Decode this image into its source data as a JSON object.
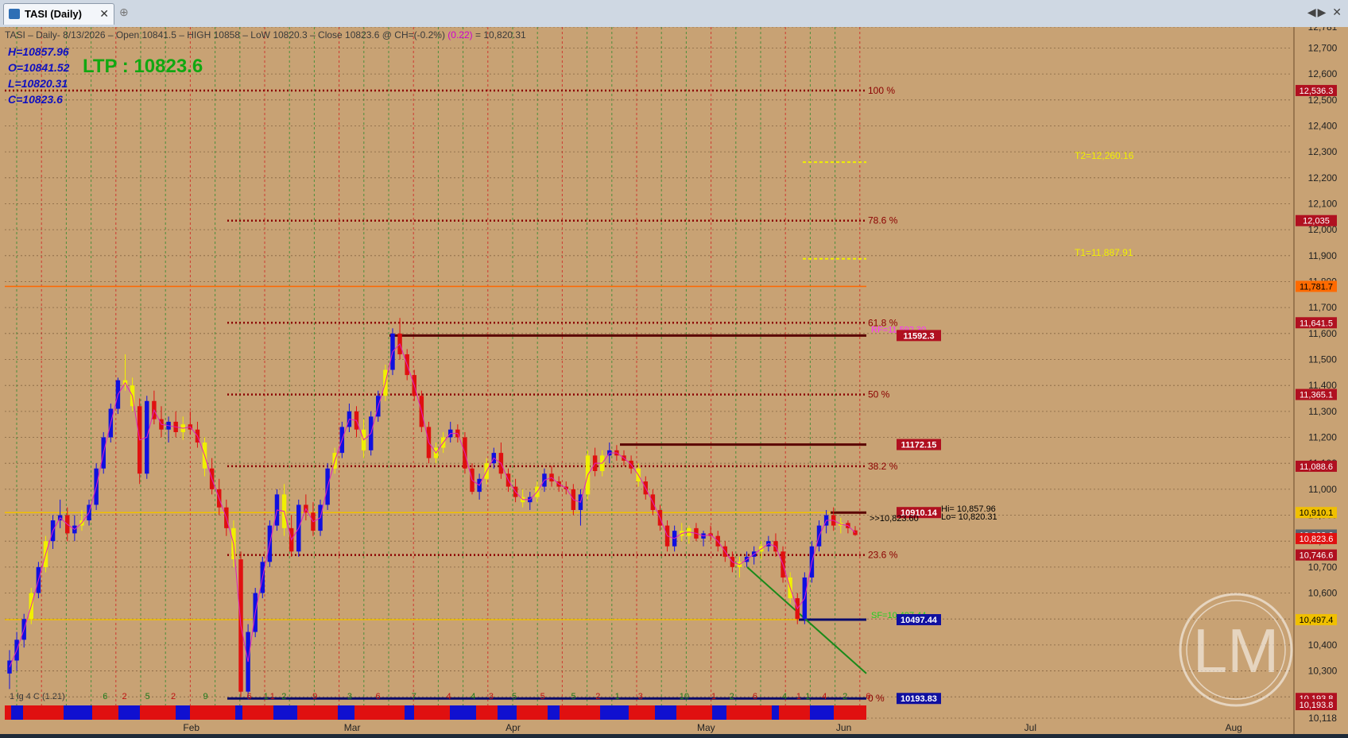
{
  "window": {
    "tab_label": "TASI (Daily)",
    "close_glyph": "✕",
    "add_glyph": "⊕",
    "nav_glyph": "◀▶ ✕"
  },
  "header": {
    "info_line": "TASI – Daily- 8/13/2026 – Open 10841.5 – HIGH 10858 – LoW 10820.3 – Close 10823.6 @ CH=(-0.2%)",
    "info_pink": "(0.22)",
    "info_tail": "= 10,820.31",
    "ohlc": [
      "H=10857.96",
      "O=10841.52",
      "L=10820.31",
      "C=10823.6"
    ],
    "ltp": "LTP : 10823.6",
    "watermark": "LM"
  },
  "colors": {
    "background": "#c8a274",
    "up_candle": "#1010e0",
    "down_candle": "#e01010",
    "neutral_candle": "#f0f000",
    "fib_line": "#8b0000",
    "yellow_line": "#f0c000",
    "orange_line": "#ff6600",
    "navy_line": "#0a0a6a",
    "green_trend": "#1a8a1a"
  },
  "chart_data": {
    "type": "candlestick",
    "symbol": "TASI",
    "timeframe": "Daily",
    "ylim": [
      10118,
      12781
    ],
    "y_ticks": [
      12781,
      12700,
      12600,
      12500,
      12400,
      12300,
      12200,
      12100,
      12000,
      11900,
      11800,
      11700,
      11600,
      11500,
      11400,
      11300,
      11200,
      11100,
      11000,
      10900,
      10800,
      10700,
      10600,
      10500,
      10400,
      10300,
      10200,
      10118
    ],
    "y_tick_labels": [
      "12,781",
      "12,700",
      "12,600",
      "12,500",
      "12,400",
      "12,300",
      "12,200",
      "12,100",
      "12,000",
      "11,900",
      "11,800",
      "11,700",
      "11,600",
      "11,500",
      "11,400",
      "11,300",
      "11,200",
      "11,100",
      "11,000",
      "10,900",
      "10,800",
      "10,700",
      "10,600",
      "10,500",
      "10,400",
      "10,300",
      "10,200",
      "10,118"
    ],
    "month_labels": [
      "Feb",
      "Mar",
      "Apr",
      "May",
      "Jun",
      "Jul",
      "Aug"
    ],
    "month_positions": [
      0.145,
      0.27,
      0.395,
      0.545,
      0.652,
      0.797,
      0.955
    ],
    "fib_levels": [
      {
        "label": "100 %",
        "value": 12536.3
      },
      {
        "label": "78.6 %",
        "value": 12035
      },
      {
        "label": "61.8 %",
        "value": 11641.5
      },
      {
        "label": "50 %",
        "value": 11365.1
      },
      {
        "label": "38.2 %",
        "value": 11088.6
      },
      {
        "label": "23.6 %",
        "value": 10746.6
      },
      {
        "label": "0 %",
        "value": 10193.8
      }
    ],
    "targets": [
      {
        "label": "T2=12,260.16",
        "value": 12260.16
      },
      {
        "label": "T1=11,887.91",
        "value": 11887.91
      }
    ],
    "rf": {
      "label": "RF=11,592.30",
      "value": 11592.3
    },
    "sf": {
      "label": "SF=10,497.44",
      "value": 10497.44
    },
    "level_boxes": [
      {
        "label": "11592.3",
        "value": 11592.3,
        "color": "#b01020"
      },
      {
        "label": "11172.15",
        "value": 11172.15,
        "color": "#b01020"
      },
      {
        "label": "10910.14",
        "value": 10910.14,
        "color": "#b01020"
      },
      {
        "label": "10497.44",
        "value": 10497.44,
        "color": "#1010a0"
      },
      {
        "label": "10193.83",
        "value": 10193.83,
        "color": "#1010a0"
      }
    ],
    "axis_boxes": [
      {
        "label": "12,536.3",
        "value": 12536.3,
        "bg": "#b01020",
        "fg": "#ffffff"
      },
      {
        "label": "12,035",
        "value": 12035,
        "bg": "#b01020",
        "fg": "#ffffff"
      },
      {
        "label": "11,781.7",
        "value": 11781.7,
        "bg": "#ff6a00",
        "fg": "#000000"
      },
      {
        "label": "11,641.5",
        "value": 11641.5,
        "bg": "#b01020",
        "fg": "#ffffff"
      },
      {
        "label": "11,365.1",
        "value": 11365.1,
        "bg": "#b01020",
        "fg": "#ffffff"
      },
      {
        "label": "11,088.6",
        "value": 11088.6,
        "bg": "#b01020",
        "fg": "#ffffff"
      },
      {
        "label": "10,910.1",
        "value": 10910.1,
        "bg": "#f0c000",
        "fg": "#000000"
      },
      {
        "label": "10,823.6",
        "value": 10823.6,
        "bg": "#5a6470",
        "fg": "#ffffff"
      },
      {
        "label": "10,823.6",
        "value": 10810,
        "bg": "#e01010",
        "fg": "#ffffff"
      },
      {
        "label": "10,746.6",
        "value": 10746.6,
        "bg": "#b01020",
        "fg": "#ffffff"
      },
      {
        "label": "10,497.4",
        "value": 10497.4,
        "bg": "#f0c000",
        "fg": "#000000"
      },
      {
        "label": "10,193.8",
        "value": 10193.8,
        "bg": "#b01020",
        "fg": "#ffffff"
      },
      {
        "label": "10,193.8",
        "value": 10170,
        "bg": "#b01020",
        "fg": "#ffffff"
      }
    ],
    "last_price_label": ">>10,823.60",
    "last_ohlc_overlay": [
      "Hi= 10,857.96",
      "Lo= 10,820.31"
    ],
    "bottom_note": "1 lg 4 C (1.21)",
    "count_labels": [
      "6",
      "2",
      "5",
      "2",
      "9",
      "6",
      "1",
      "1",
      "2",
      "9",
      "3",
      "6",
      "7",
      "4",
      "4",
      "3",
      "5",
      "5",
      "5",
      "2",
      "1",
      "3",
      "10",
      "1",
      "2",
      "6",
      "4",
      "1",
      "1",
      "4",
      "2",
      "6"
    ],
    "count_positions": [
      0.078,
      0.093,
      0.111,
      0.131,
      0.156,
      0.19,
      0.203,
      0.208,
      0.217,
      0.241,
      0.268,
      0.29,
      0.318,
      0.345,
      0.364,
      0.378,
      0.396,
      0.418,
      0.442,
      0.461,
      0.476,
      0.494,
      0.528,
      0.551,
      0.565,
      0.583,
      0.606,
      0.617,
      0.624,
      0.637,
      0.653,
      0.671
    ],
    "candles": [
      {
        "o": 10290,
        "h": 10380,
        "l": 10230,
        "c": 10340
      },
      {
        "o": 10340,
        "h": 10450,
        "l": 10300,
        "c": 10420
      },
      {
        "o": 10420,
        "h": 10520,
        "l": 10390,
        "c": 10500
      },
      {
        "o": 10500,
        "h": 10620,
        "l": 10480,
        "c": 10600
      },
      {
        "o": 10600,
        "h": 10720,
        "l": 10580,
        "c": 10700
      },
      {
        "o": 10700,
        "h": 10820,
        "l": 10680,
        "c": 10800
      },
      {
        "o": 10800,
        "h": 10900,
        "l": 10770,
        "c": 10880
      },
      {
        "o": 10880,
        "h": 10960,
        "l": 10850,
        "c": 10900
      },
      {
        "o": 10900,
        "h": 10930,
        "l": 10800,
        "c": 10830
      },
      {
        "o": 10830,
        "h": 10900,
        "l": 10800,
        "c": 10860
      },
      {
        "o": 10860,
        "h": 10920,
        "l": 10840,
        "c": 10880
      },
      {
        "o": 10880,
        "h": 10960,
        "l": 10860,
        "c": 10940
      },
      {
        "o": 10940,
        "h": 11100,
        "l": 10920,
        "c": 11080
      },
      {
        "o": 11080,
        "h": 11220,
        "l": 11060,
        "c": 11200
      },
      {
        "o": 11200,
        "h": 11330,
        "l": 11180,
        "c": 11310
      },
      {
        "o": 11310,
        "h": 11430,
        "l": 11290,
        "c": 11420
      },
      {
        "o": 11420,
        "h": 11520,
        "l": 11380,
        "c": 11400
      },
      {
        "o": 11400,
        "h": 11430,
        "l": 11300,
        "c": 11320
      },
      {
        "o": 11320,
        "h": 11350,
        "l": 11020,
        "c": 11060
      },
      {
        "o": 11060,
        "h": 11360,
        "l": 11040,
        "c": 11340
      },
      {
        "o": 11340,
        "h": 11380,
        "l": 11250,
        "c": 11270
      },
      {
        "o": 11270,
        "h": 11320,
        "l": 11200,
        "c": 11230
      },
      {
        "o": 11230,
        "h": 11280,
        "l": 11180,
        "c": 11260
      },
      {
        "o": 11260,
        "h": 11300,
        "l": 11200,
        "c": 11220
      },
      {
        "o": 11220,
        "h": 11280,
        "l": 11190,
        "c": 11250
      },
      {
        "o": 11250,
        "h": 11300,
        "l": 11210,
        "c": 11230
      },
      {
        "o": 11230,
        "h": 11260,
        "l": 11160,
        "c": 11180
      },
      {
        "o": 11180,
        "h": 11200,
        "l": 11050,
        "c": 11080
      },
      {
        "o": 11080,
        "h": 11120,
        "l": 10980,
        "c": 11000
      },
      {
        "o": 11000,
        "h": 11040,
        "l": 10900,
        "c": 10930
      },
      {
        "o": 10930,
        "h": 10960,
        "l": 10820,
        "c": 10850
      },
      {
        "o": 10850,
        "h": 10880,
        "l": 10700,
        "c": 10730
      },
      {
        "o": 10730,
        "h": 10760,
        "l": 10200,
        "c": 10220
      },
      {
        "o": 10220,
        "h": 10480,
        "l": 10190,
        "c": 10450
      },
      {
        "o": 10450,
        "h": 10620,
        "l": 10430,
        "c": 10600
      },
      {
        "o": 10600,
        "h": 10740,
        "l": 10580,
        "c": 10720
      },
      {
        "o": 10720,
        "h": 10880,
        "l": 10700,
        "c": 10860
      },
      {
        "o": 10860,
        "h": 11000,
        "l": 10840,
        "c": 10980
      },
      {
        "o": 10980,
        "h": 11020,
        "l": 10820,
        "c": 10850
      },
      {
        "o": 10850,
        "h": 10900,
        "l": 10740,
        "c": 10760
      },
      {
        "o": 10760,
        "h": 10960,
        "l": 10740,
        "c": 10940
      },
      {
        "o": 10940,
        "h": 10980,
        "l": 10880,
        "c": 10910
      },
      {
        "o": 10910,
        "h": 10950,
        "l": 10820,
        "c": 10840
      },
      {
        "o": 10840,
        "h": 10960,
        "l": 10820,
        "c": 10940
      },
      {
        "o": 10940,
        "h": 11100,
        "l": 10920,
        "c": 11080
      },
      {
        "o": 11080,
        "h": 11160,
        "l": 11060,
        "c": 11140
      },
      {
        "o": 11140,
        "h": 11260,
        "l": 11120,
        "c": 11240
      },
      {
        "o": 11240,
        "h": 11330,
        "l": 11220,
        "c": 11300
      },
      {
        "o": 11300,
        "h": 11320,
        "l": 11200,
        "c": 11230
      },
      {
        "o": 11230,
        "h": 11270,
        "l": 11120,
        "c": 11150
      },
      {
        "o": 11150,
        "h": 11300,
        "l": 11130,
        "c": 11280
      },
      {
        "o": 11280,
        "h": 11380,
        "l": 11260,
        "c": 11360
      },
      {
        "o": 11360,
        "h": 11480,
        "l": 11340,
        "c": 11460
      },
      {
        "o": 11460,
        "h": 11620,
        "l": 11440,
        "c": 11600
      },
      {
        "o": 11600,
        "h": 11660,
        "l": 11500,
        "c": 11520
      },
      {
        "o": 11520,
        "h": 11540,
        "l": 11420,
        "c": 11440
      },
      {
        "o": 11440,
        "h": 11460,
        "l": 11340,
        "c": 11360
      },
      {
        "o": 11360,
        "h": 11380,
        "l": 11220,
        "c": 11240
      },
      {
        "o": 11240,
        "h": 11260,
        "l": 11100,
        "c": 11120
      },
      {
        "o": 11120,
        "h": 11180,
        "l": 11100,
        "c": 11160
      },
      {
        "o": 11160,
        "h": 11220,
        "l": 11140,
        "c": 11200
      },
      {
        "o": 11200,
        "h": 11260,
        "l": 11180,
        "c": 11230
      },
      {
        "o": 11230,
        "h": 11250,
        "l": 11180,
        "c": 11200
      },
      {
        "o": 11200,
        "h": 11220,
        "l": 11060,
        "c": 11080
      },
      {
        "o": 11080,
        "h": 11100,
        "l": 10980,
        "c": 10990
      },
      {
        "o": 10990,
        "h": 11060,
        "l": 10960,
        "c": 11040
      },
      {
        "o": 11040,
        "h": 11120,
        "l": 11020,
        "c": 11100
      },
      {
        "o": 11100,
        "h": 11160,
        "l": 11080,
        "c": 11140
      },
      {
        "o": 11140,
        "h": 11180,
        "l": 11040,
        "c": 11060
      },
      {
        "o": 11060,
        "h": 11080,
        "l": 10990,
        "c": 11010
      },
      {
        "o": 11010,
        "h": 11040,
        "l": 10950,
        "c": 10970
      },
      {
        "o": 10970,
        "h": 11000,
        "l": 10930,
        "c": 10950
      },
      {
        "o": 10950,
        "h": 10990,
        "l": 10920,
        "c": 10970
      },
      {
        "o": 10970,
        "h": 11030,
        "l": 10950,
        "c": 11010
      },
      {
        "o": 11010,
        "h": 11080,
        "l": 10990,
        "c": 11060
      },
      {
        "o": 11060,
        "h": 11090,
        "l": 11010,
        "c": 11030
      },
      {
        "o": 11030,
        "h": 11050,
        "l": 10990,
        "c": 11010
      },
      {
        "o": 11010,
        "h": 11030,
        "l": 10980,
        "c": 11000
      },
      {
        "o": 11000,
        "h": 11020,
        "l": 10900,
        "c": 10920
      },
      {
        "o": 10920,
        "h": 11000,
        "l": 10860,
        "c": 10980
      },
      {
        "o": 10980,
        "h": 11150,
        "l": 10960,
        "c": 11130
      },
      {
        "o": 11130,
        "h": 11160,
        "l": 11050,
        "c": 11070
      },
      {
        "o": 11070,
        "h": 11150,
        "l": 11050,
        "c": 11130
      },
      {
        "o": 11130,
        "h": 11180,
        "l": 11100,
        "c": 11150
      },
      {
        "o": 11150,
        "h": 11170,
        "l": 11110,
        "c": 11130
      },
      {
        "o": 11130,
        "h": 11150,
        "l": 11090,
        "c": 11110
      },
      {
        "o": 11110,
        "h": 11130,
        "l": 11060,
        "c": 11080
      },
      {
        "o": 11080,
        "h": 11100,
        "l": 11010,
        "c": 11030
      },
      {
        "o": 11030,
        "h": 11050,
        "l": 10960,
        "c": 10980
      },
      {
        "o": 10980,
        "h": 11000,
        "l": 10900,
        "c": 10920
      },
      {
        "o": 10920,
        "h": 10940,
        "l": 10840,
        "c": 10860
      },
      {
        "o": 10860,
        "h": 10880,
        "l": 10760,
        "c": 10780
      },
      {
        "o": 10780,
        "h": 10860,
        "l": 10760,
        "c": 10840
      },
      {
        "o": 10840,
        "h": 10870,
        "l": 10800,
        "c": 10820
      },
      {
        "o": 10820,
        "h": 10860,
        "l": 10790,
        "c": 10850
      },
      {
        "o": 10850,
        "h": 10870,
        "l": 10800,
        "c": 10810
      },
      {
        "o": 10810,
        "h": 10840,
        "l": 10780,
        "c": 10830
      },
      {
        "o": 10830,
        "h": 10860,
        "l": 10800,
        "c": 10820
      },
      {
        "o": 10820,
        "h": 10840,
        "l": 10760,
        "c": 10780
      },
      {
        "o": 10780,
        "h": 10800,
        "l": 10720,
        "c": 10740
      },
      {
        "o": 10740,
        "h": 10760,
        "l": 10680,
        "c": 10700
      },
      {
        "o": 10700,
        "h": 10740,
        "l": 10660,
        "c": 10720
      },
      {
        "o": 10720,
        "h": 10760,
        "l": 10700,
        "c": 10740
      },
      {
        "o": 10740,
        "h": 10780,
        "l": 10710,
        "c": 10760
      },
      {
        "o": 10760,
        "h": 10800,
        "l": 10730,
        "c": 10780
      },
      {
        "o": 10780,
        "h": 10820,
        "l": 10760,
        "c": 10800
      },
      {
        "o": 10800,
        "h": 10830,
        "l": 10740,
        "c": 10760
      },
      {
        "o": 10760,
        "h": 10780,
        "l": 10640,
        "c": 10660
      },
      {
        "o": 10660,
        "h": 10680,
        "l": 10560,
        "c": 10580
      },
      {
        "o": 10580,
        "h": 10600,
        "l": 10480,
        "c": 10500
      },
      {
        "o": 10500,
        "h": 10680,
        "l": 10480,
        "c": 10660
      },
      {
        "o": 10660,
        "h": 10800,
        "l": 10640,
        "c": 10780
      },
      {
        "o": 10780,
        "h": 10880,
        "l": 10760,
        "c": 10860
      },
      {
        "o": 10860,
        "h": 10920,
        "l": 10830,
        "c": 10900
      },
      {
        "o": 10900,
        "h": 10930,
        "l": 10840,
        "c": 10860
      },
      {
        "o": 10860,
        "h": 10890,
        "l": 10830,
        "c": 10870
      },
      {
        "o": 10870,
        "h": 10880,
        "l": 10830,
        "c": 10850
      },
      {
        "o": 10841.5,
        "h": 10858,
        "l": 10820.3,
        "c": 10823.6
      }
    ]
  }
}
